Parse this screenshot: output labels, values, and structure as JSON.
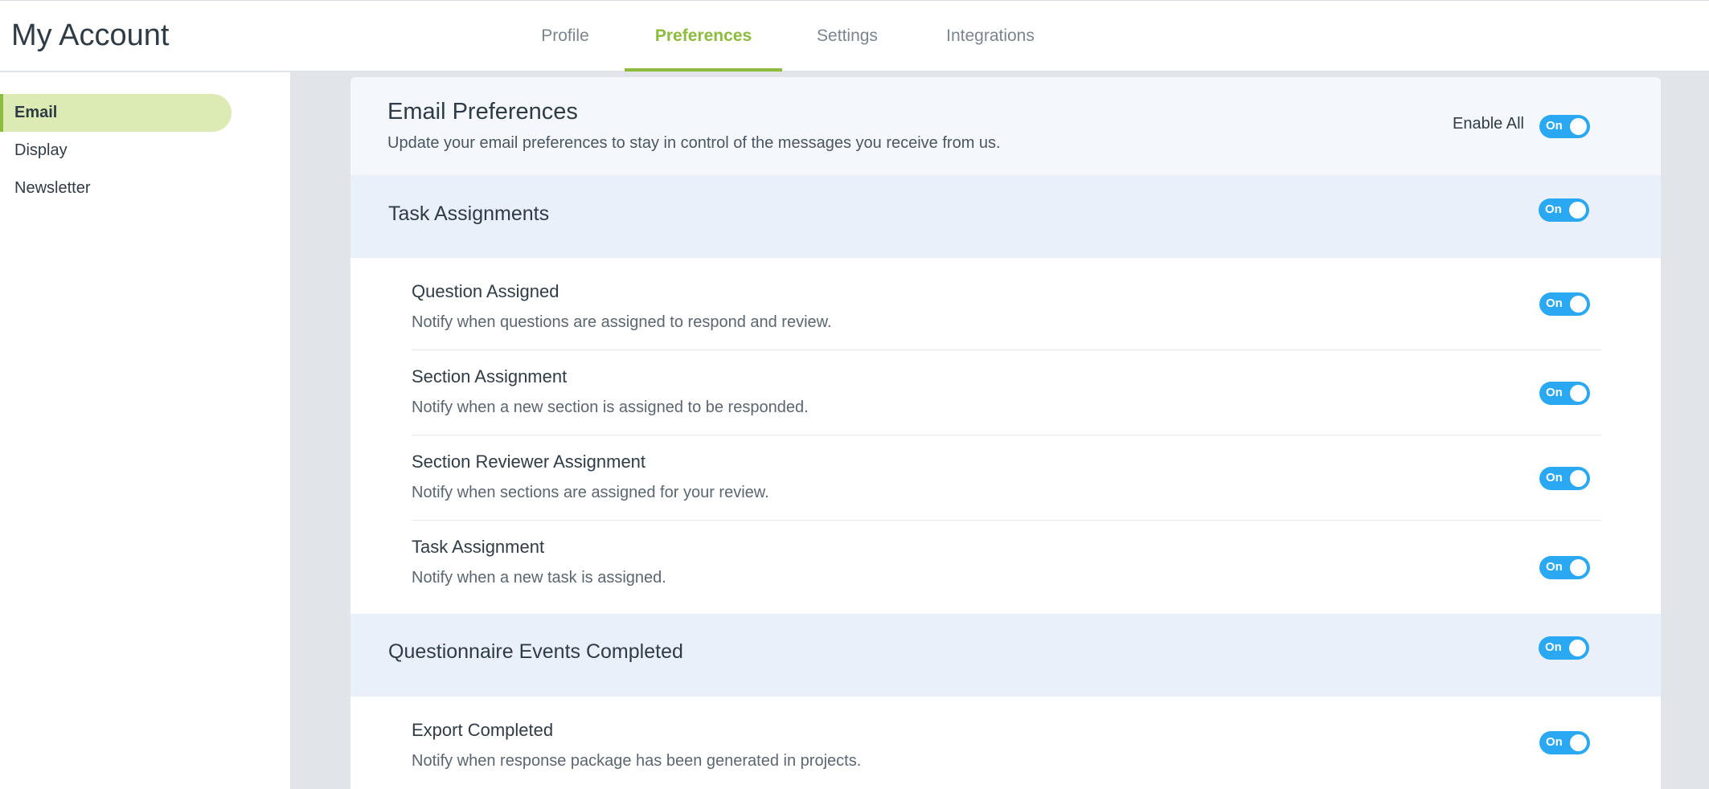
{
  "header": {
    "title": "My Account",
    "tabs": [
      {
        "label": "Profile"
      },
      {
        "label": "Preferences"
      },
      {
        "label": "Settings"
      },
      {
        "label": "Integrations"
      }
    ],
    "active_tab": "Preferences"
  },
  "sidebar": {
    "items": [
      {
        "label": "Email"
      },
      {
        "label": "Display"
      },
      {
        "label": "Newsletter"
      }
    ],
    "active_item": "Email"
  },
  "email_prefs": {
    "title": "Email Preferences",
    "subtitle": "Update your email preferences to stay in control of the messages you receive from us.",
    "enable_all_label": "Enable All",
    "enable_all_state": "On"
  },
  "sections": [
    {
      "title": "Task Assignments",
      "state": "On",
      "items": [
        {
          "title": "Question Assigned",
          "desc": "Notify when questions are assigned to respond and review.",
          "state": "On"
        },
        {
          "title": "Section Assignment",
          "desc": "Notify when a new section is assigned to be responded.",
          "state": "On"
        },
        {
          "title": "Section Reviewer Assignment",
          "desc": "Notify when sections are assigned for your review.",
          "state": "On"
        },
        {
          "title": "Task Assignment",
          "desc": "Notify when a new task is assigned.",
          "state": "On"
        }
      ]
    },
    {
      "title": "Questionnaire Events Completed",
      "state": "On",
      "items": [
        {
          "title": "Export Completed",
          "desc": "Notify when response package has been generated in projects.",
          "state": "On"
        }
      ]
    }
  ],
  "colors": {
    "accent_green": "#8dbb3e",
    "toggle_blue": "#2aa8f2",
    "sidebar_active_bg": "#dcebb3",
    "section_band_bg": "#e9f0fa"
  }
}
